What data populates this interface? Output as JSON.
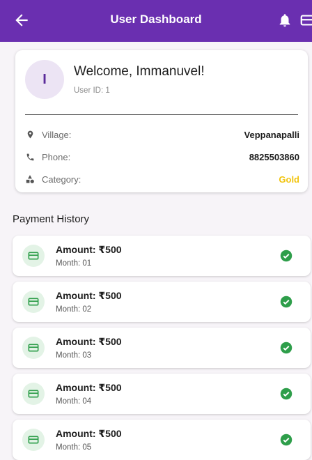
{
  "appbar": {
    "title": "User Dashboard",
    "color": "#6a2fb0"
  },
  "profile": {
    "initial": "I",
    "welcome": "Welcome, Immanuvel!",
    "user_id": "User ID: 1",
    "rows": [
      {
        "icon": "location-pin-icon",
        "label": "Village:",
        "value": "Veppanapalli"
      },
      {
        "icon": "phone-icon",
        "label": "Phone:",
        "value": "8825503860"
      },
      {
        "icon": "category-icon",
        "label": "Category:",
        "value": "Gold"
      }
    ],
    "gold_color": "#f1c40f"
  },
  "payments": {
    "title": "Payment History",
    "items": [
      {
        "amount": "Amount: ₹500",
        "month": "Month: 01"
      },
      {
        "amount": "Amount: ₹500",
        "month": "Month: 02"
      },
      {
        "amount": "Amount: ₹500",
        "month": "Month: 03"
      },
      {
        "amount": "Amount: ₹500",
        "month": "Month: 04"
      },
      {
        "amount": "Amount: ₹500",
        "month": "Month: 05"
      }
    ],
    "accent": "#2e9e4a"
  }
}
